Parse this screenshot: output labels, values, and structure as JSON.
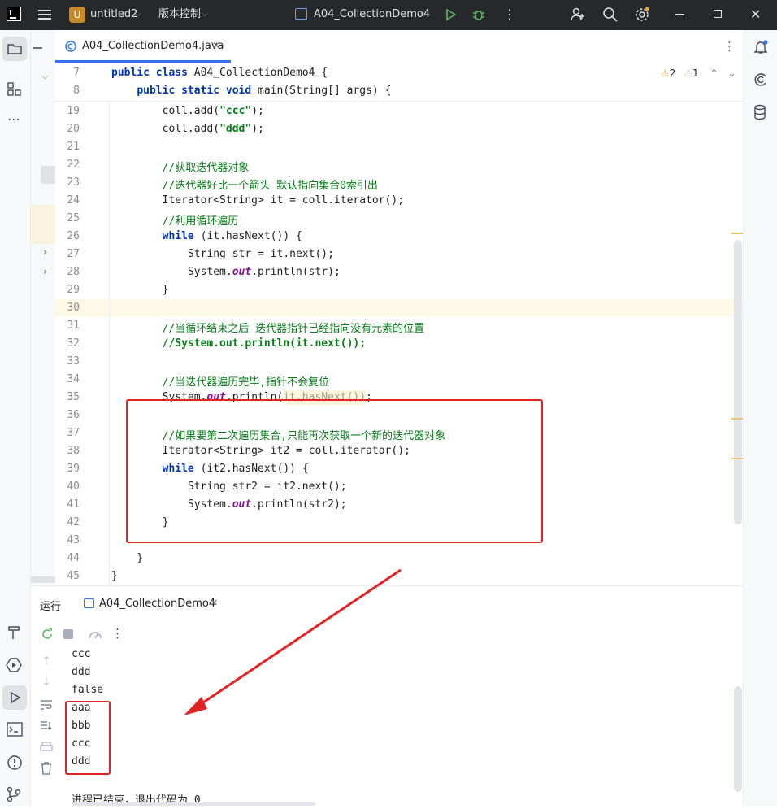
{
  "titlebar": {
    "project_badge": "U",
    "project_name": "untitled2",
    "vcs_label": "版本控制",
    "run_config": "A04_CollectionDemo4"
  },
  "editor_tab": {
    "label": "A04_CollectionDemo4.java"
  },
  "inspections": {
    "warnings": "2",
    "weak_warnings": "1"
  },
  "code": {
    "sticky": [
      {
        "num": "7",
        "parts": [
          [
            "kw",
            "public class "
          ],
          [
            "",
            "A04_CollectionDemo4 {"
          ]
        ]
      },
      {
        "num": "8",
        "parts": [
          [
            "",
            "    "
          ],
          [
            "kw",
            "public static void "
          ],
          [
            "",
            "main(String[] args) {"
          ]
        ]
      }
    ],
    "lines": [
      {
        "num": "19",
        "parts": [
          [
            "",
            "        coll.add("
          ],
          [
            "str",
            "\"ccc\""
          ],
          [
            "",
            ");"
          ]
        ]
      },
      {
        "num": "20",
        "parts": [
          [
            "",
            "        coll.add("
          ],
          [
            "str",
            "\"ddd\""
          ],
          [
            "",
            ");"
          ]
        ]
      },
      {
        "num": "21",
        "parts": []
      },
      {
        "num": "22",
        "parts": [
          [
            "cmg",
            "        //获取迭代器对象"
          ]
        ]
      },
      {
        "num": "23",
        "parts": [
          [
            "cmg",
            "        //迭代器好比一个箭头 默认指向集合0索引出"
          ]
        ]
      },
      {
        "num": "24",
        "parts": [
          [
            "",
            "        Iterator<String> it = coll.iterator();"
          ]
        ]
      },
      {
        "num": "25",
        "parts": [
          [
            "cmg",
            "        //利用循环遍历"
          ]
        ]
      },
      {
        "num": "26",
        "parts": [
          [
            "",
            "        "
          ],
          [
            "kw",
            "while "
          ],
          [
            "",
            "(it.hasNext()) {"
          ]
        ]
      },
      {
        "num": "27",
        "parts": [
          [
            "",
            "            String str = it.next();"
          ]
        ]
      },
      {
        "num": "28",
        "parts": [
          [
            "",
            "            System."
          ],
          [
            "fld",
            "out"
          ],
          [
            "",
            ".println(str);"
          ]
        ]
      },
      {
        "num": "29",
        "parts": [
          [
            "",
            "        }"
          ]
        ]
      },
      {
        "num": "30",
        "parts": []
      },
      {
        "num": "31",
        "parts": [
          [
            "cmg",
            "        //当循环结束之后 迭代器指针已经指向没有元素的位置"
          ]
        ]
      },
      {
        "num": "32",
        "parts": [
          [
            "cmgb",
            "        //System.out.println(it.next());"
          ]
        ]
      },
      {
        "num": "33",
        "parts": []
      },
      {
        "num": "34",
        "parts": [
          [
            "cmg",
            "        //当迭代器遍历完毕,指针不会复位"
          ]
        ]
      },
      {
        "num": "35",
        "parts": [
          [
            "",
            "        System."
          ],
          [
            "fld",
            "out"
          ],
          [
            "",
            ".println(it.hasNext());"
          ]
        ]
      },
      {
        "num": "36",
        "parts": []
      },
      {
        "num": "37",
        "parts": [
          [
            "cmg",
            "        //如果要第二次遍历集合,只能再次获取一个新的迭代器对象"
          ]
        ]
      },
      {
        "num": "38",
        "parts": [
          [
            "",
            "        Iterator<String> it2 = coll.iterator();"
          ]
        ]
      },
      {
        "num": "39",
        "parts": [
          [
            "",
            "        "
          ],
          [
            "kw",
            "while "
          ],
          [
            "",
            "(it2.hasNext()) {"
          ]
        ]
      },
      {
        "num": "40",
        "parts": [
          [
            "",
            "            String str2 = it2.next();"
          ]
        ]
      },
      {
        "num": "41",
        "parts": [
          [
            "",
            "            System."
          ],
          [
            "fld",
            "out"
          ],
          [
            "",
            ".println(str2);"
          ]
        ]
      },
      {
        "num": "42",
        "parts": [
          [
            "",
            "        }"
          ]
        ]
      },
      {
        "num": "43",
        "parts": []
      },
      {
        "num": "44",
        "parts": [
          [
            "",
            "    }"
          ]
        ]
      },
      {
        "num": "45",
        "parts": [
          [
            "",
            "}"
          ]
        ]
      }
    ]
  },
  "run_panel": {
    "title": "运行",
    "tab_label": "A04_CollectionDemo4"
  },
  "console": {
    "lines": [
      "ccc",
      "ddd",
      "false",
      "aaa",
      "bbb",
      "ccc",
      "ddd",
      ""
    ],
    "exit_message": "进程已结束，退出代码为 0"
  },
  "colors": {
    "annotation_red": "#e02424",
    "keyword": "#0033b3",
    "string": "#067d17",
    "accent": "#3574f0"
  }
}
